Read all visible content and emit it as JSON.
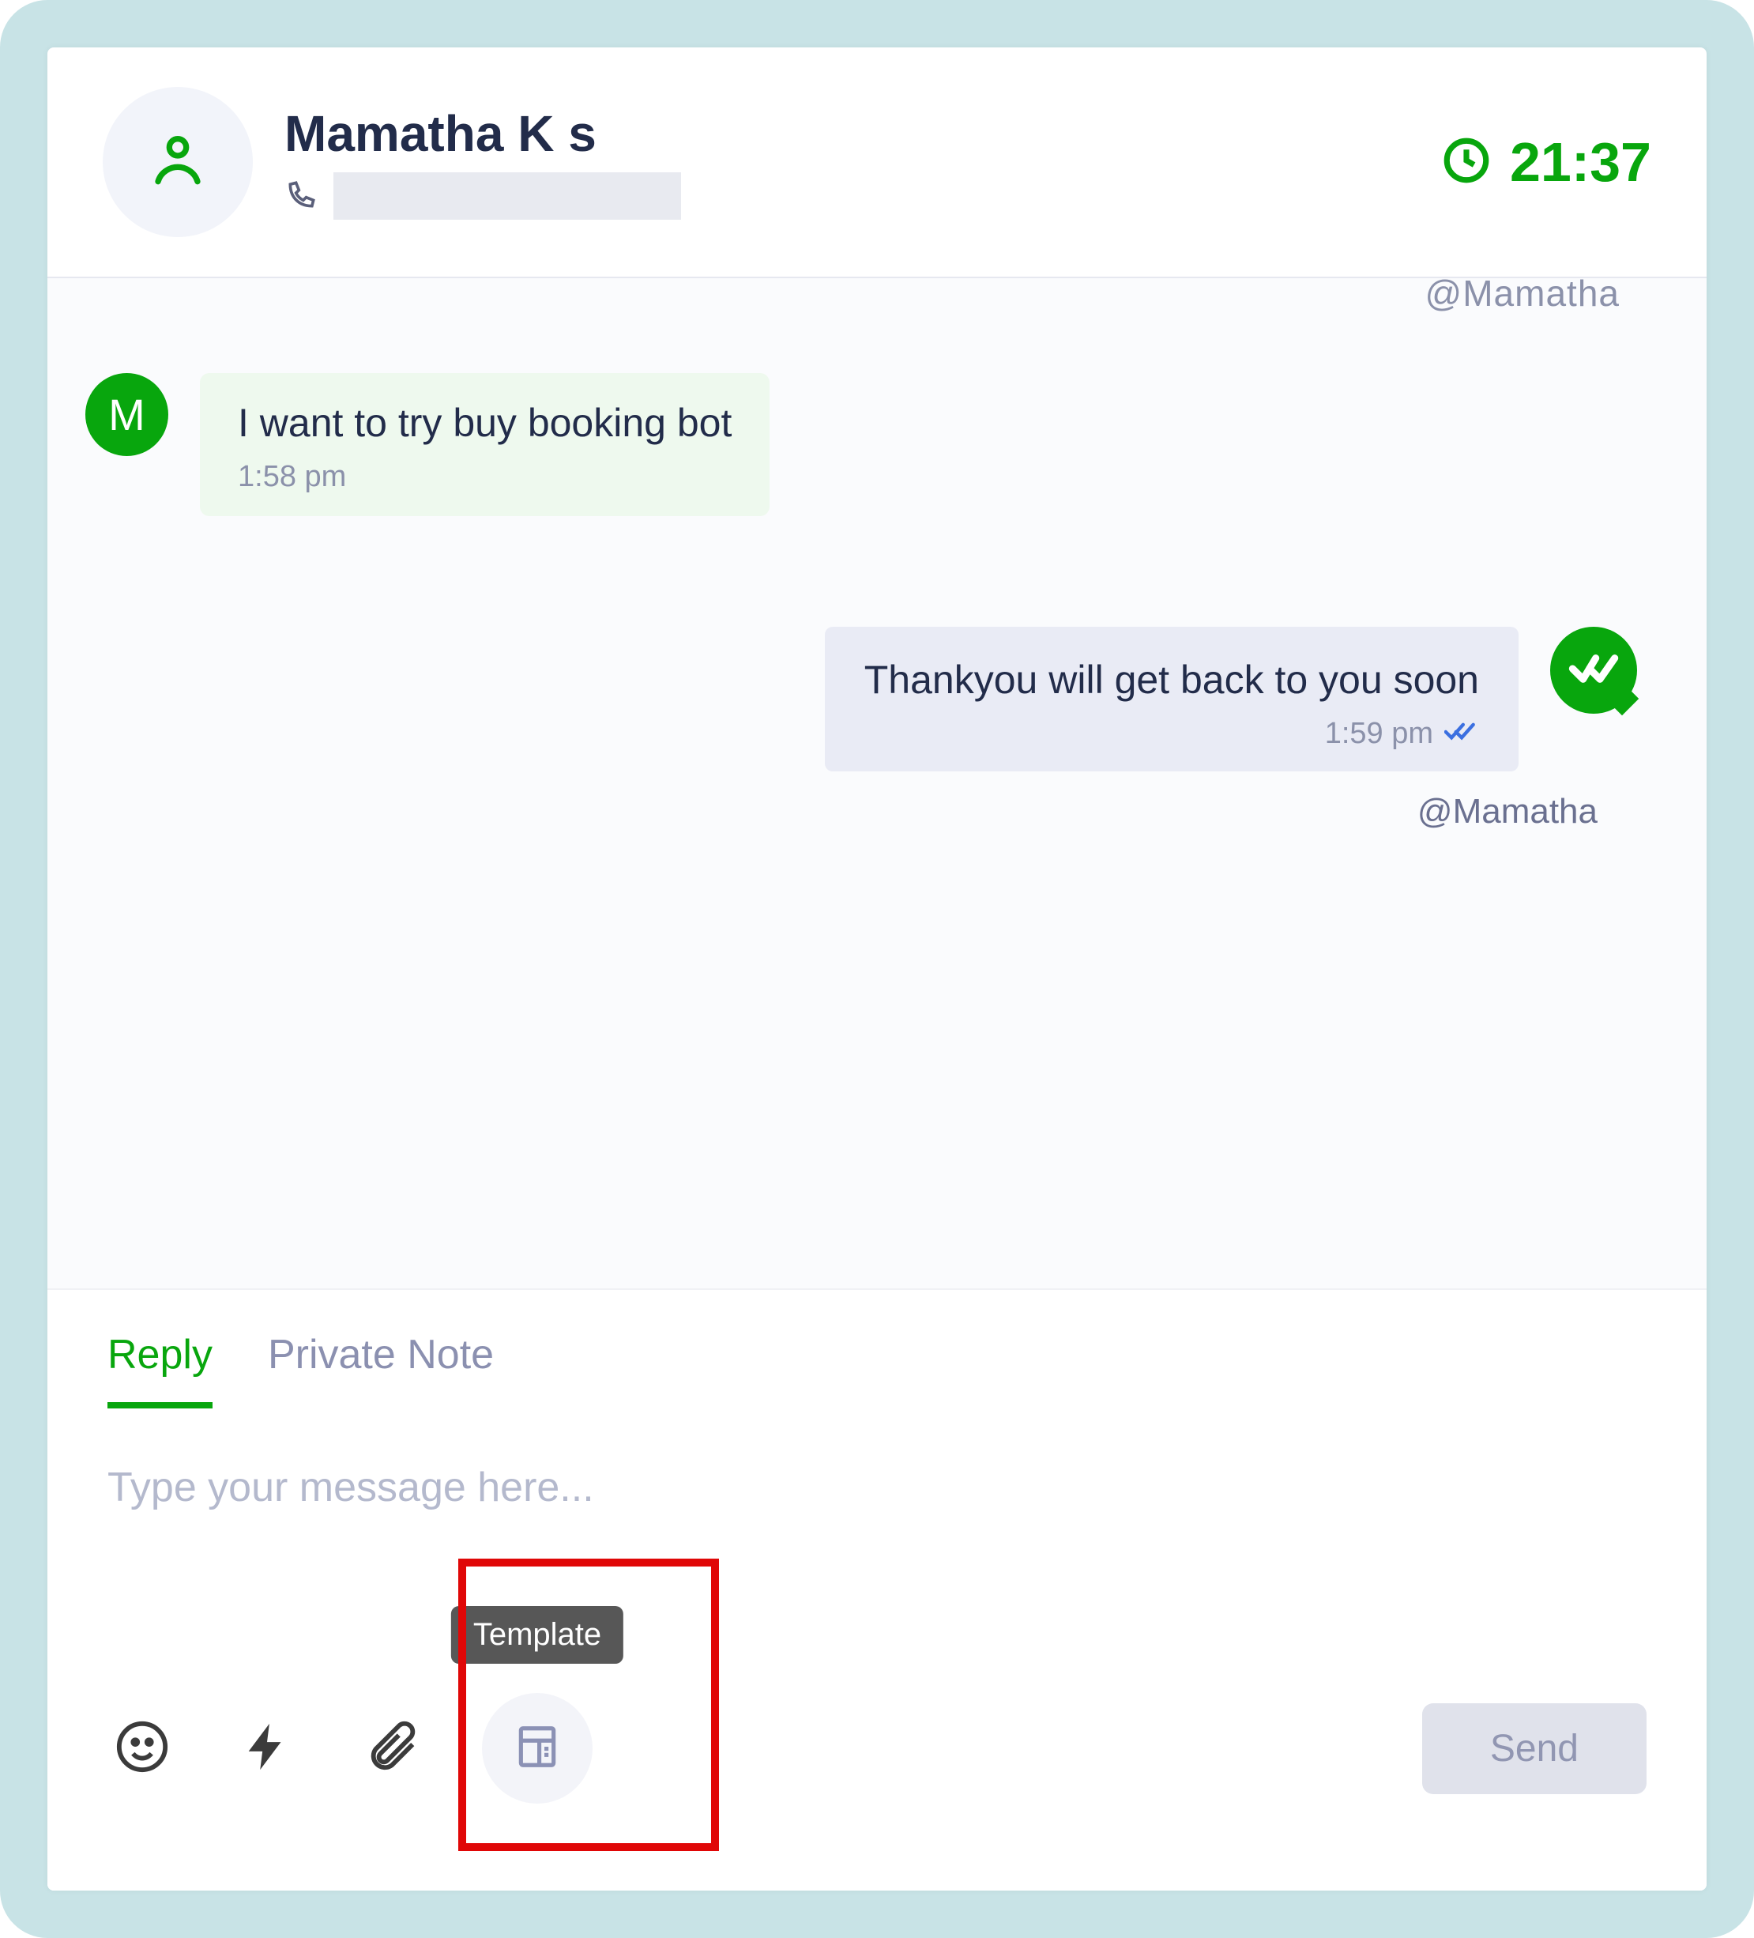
{
  "header": {
    "contact_name": "Mamatha K s",
    "contact_avatar_letter": "M",
    "timer": "21:37"
  },
  "chat": {
    "mention_partial": "@Mamatha",
    "incoming": {
      "text": "I want to try buy booking bot",
      "time": "1:58 pm"
    },
    "outgoing": {
      "text": "Thankyou will get back to you soon",
      "time": "1:59 pm",
      "mention": "@Mamatha"
    }
  },
  "composer": {
    "tabs": {
      "reply": "Reply",
      "private_note": "Private Note"
    },
    "placeholder": "Type your message here...",
    "template_tooltip": "Template",
    "send_label": "Send"
  }
}
